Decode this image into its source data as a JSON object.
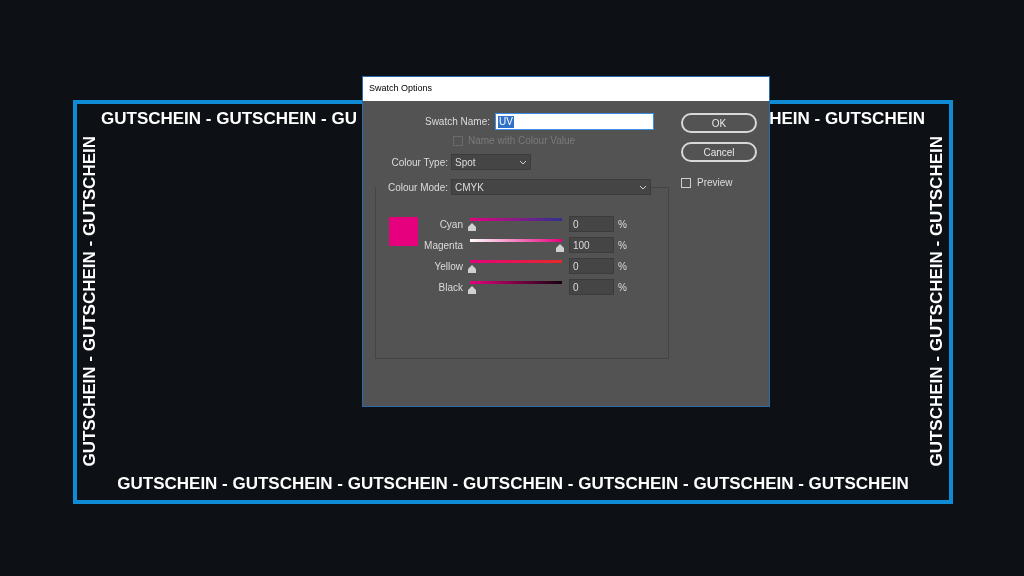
{
  "background": {
    "top_left": "GUTSCHEIN - GUTSCHEIN - GU",
    "top_right": "HEIN - GUTSCHEIN",
    "left": "GUTSCHEIN - GUTSCHEIN - GUTSCHEIN",
    "right": "GUTSCHEIN - GUTSCHEIN - GUTSCHEIN",
    "bottom": "GUTSCHEIN - GUTSCHEIN - GUTSCHEIN - GUTSCHEIN - GUTSCHEIN - GUTSCHEIN - GUTSCHEIN"
  },
  "dialog": {
    "title": "Swatch Options",
    "swatch_name": {
      "label": "Swatch Name:",
      "value": "UV"
    },
    "name_with_colour_value": {
      "label": "Name with Colour Value",
      "checked": false,
      "disabled": true
    },
    "colour_type": {
      "label": "Colour Type:",
      "value": "Spot"
    },
    "colour_mode": {
      "label": "Colour Mode:",
      "value": "CMYK"
    },
    "channels": [
      {
        "kind": "cyan",
        "name": "Cyan",
        "level": 0,
        "value": "0",
        "unit": "%"
      },
      {
        "kind": "magenta",
        "name": "Magenta",
        "level": 1,
        "value": "100",
        "unit": "%"
      },
      {
        "kind": "yellow",
        "name": "Yellow",
        "level": 0,
        "value": "0",
        "unit": "%"
      },
      {
        "kind": "black",
        "name": "Black",
        "level": 0,
        "value": "0",
        "unit": "%"
      }
    ],
    "buttons": [
      "OK",
      "Cancel"
    ],
    "preview": {
      "label": "Preview",
      "checked": false
    }
  }
}
